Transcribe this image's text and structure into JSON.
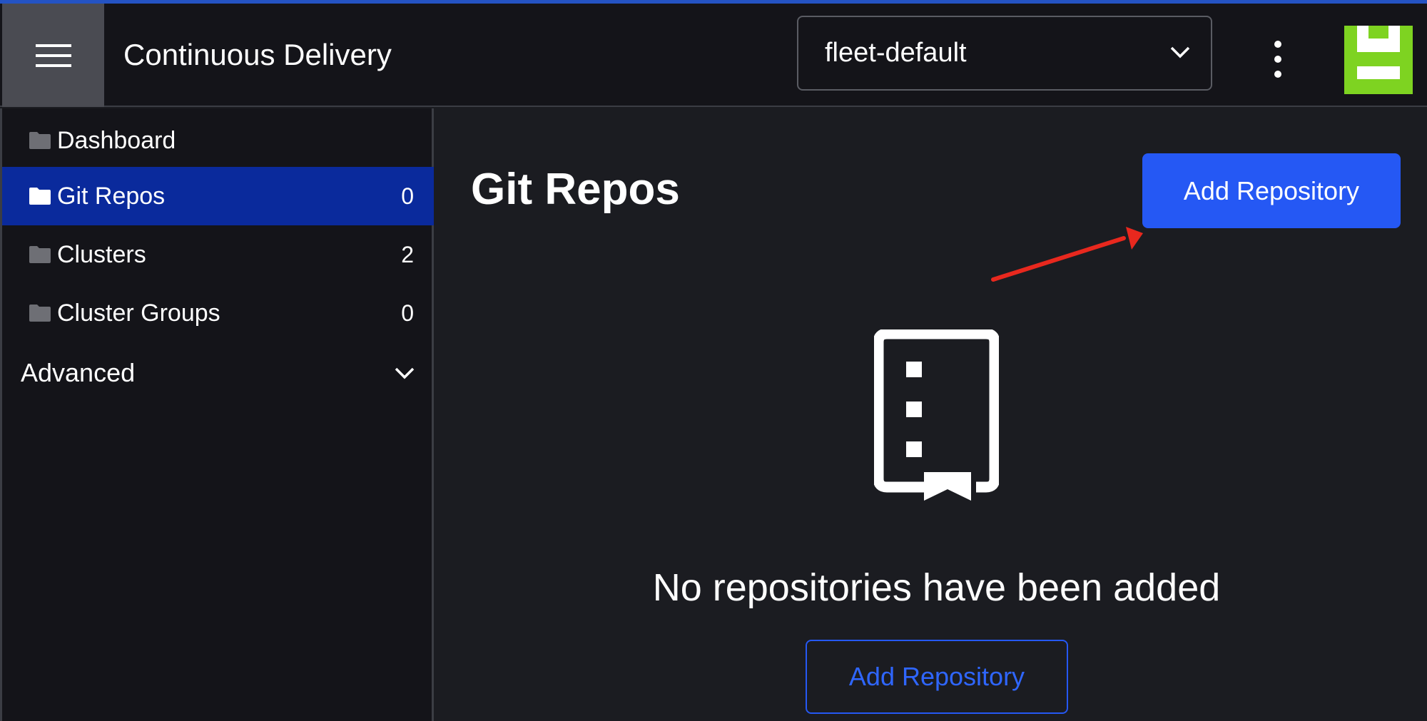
{
  "header": {
    "app_title": "Continuous Delivery",
    "workspace_selected": "fleet-default",
    "menu_icon": "hamburger-icon",
    "more_icon": "kebab-icon",
    "avatar_colors": [
      "#7ed321",
      "#ffffff"
    ]
  },
  "sidebar": {
    "items": [
      {
        "label": "Dashboard",
        "count": "",
        "active": false
      },
      {
        "label": "Git Repos",
        "count": "0",
        "active": true
      },
      {
        "label": "Clusters",
        "count": "2",
        "active": false
      },
      {
        "label": "Cluster Groups",
        "count": "0",
        "active": false
      }
    ],
    "advanced_label": "Advanced"
  },
  "main": {
    "title": "Git Repos",
    "add_button_label": "Add Repository",
    "empty_message": "No repositories have been added",
    "empty_add_button_label": "Add Repository",
    "empty_icon": "repository-icon"
  },
  "colors": {
    "accent": "#2558f4",
    "active_nav": "#0a2a9c",
    "annotation_arrow": "#e8281e"
  }
}
